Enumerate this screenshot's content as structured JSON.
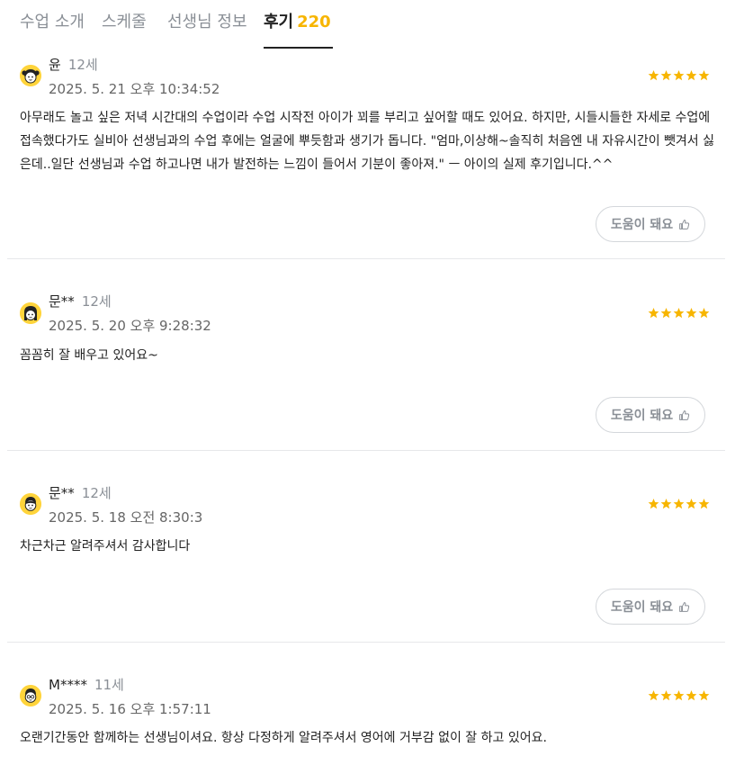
{
  "tabs": {
    "intro": "수업 소개",
    "schedule": "스케줄",
    "teacher": "선생님 정보",
    "reviews": "후기",
    "reviews_count": "220"
  },
  "colors": {
    "accent": "#f7b500",
    "star": "#f7b500",
    "avatar_bg": "#ffd43b"
  },
  "helpful_label": "도움이 돼요",
  "helpful_icon": "thumbs-up-icon",
  "reviews": [
    {
      "name": "윤",
      "age": "12세",
      "date": "2025. 5. 21 오후 10:34:52",
      "rating": 5,
      "avatar": "girl-avatar-icon",
      "text": "아무래도 놀고 싶은 저녁 시간대의 수업이라 수업 시작전 아이가 꾀를 부리고 싶어할 때도 있어요. 하지만, 시들시들한 자세로 수업에 접속했다가도 실비아 선생님과의 수업 후에는 얼굴에 뿌듯함과 생기가 돕니다. \"엄마,이상해~솔직히 처음엔 내 자유시간이 뺏겨서 싫은데..일단 선생님과 수업 하고나면 내가 발전하는 느낌이 들어서 기분이 좋아져.\" ㅡ 아이의 실제 후기입니다.^^"
    },
    {
      "name": "문**",
      "age": "12세",
      "date": "2025. 5. 20 오후 9:28:32",
      "rating": 5,
      "avatar": "girl-avatar-icon",
      "text": "꼼꼼히 잘 배우고 있어요~"
    },
    {
      "name": "문**",
      "age": "12세",
      "date": "2025. 5. 18 오전 8:30:3",
      "rating": 5,
      "avatar": "boy-avatar-icon",
      "text": "차근차근 알려주셔서 감사합니다"
    },
    {
      "name": "M****",
      "age": "11세",
      "date": "2025. 5. 16 오후 1:57:11",
      "rating": 5,
      "avatar": "boy-glasses-avatar-icon",
      "text": "오랜기간동안 함께하는 선생님이셔요. 항상 다정하게 알려주셔서 영어에 거부감 없이 잘 하고 있어요."
    }
  ]
}
